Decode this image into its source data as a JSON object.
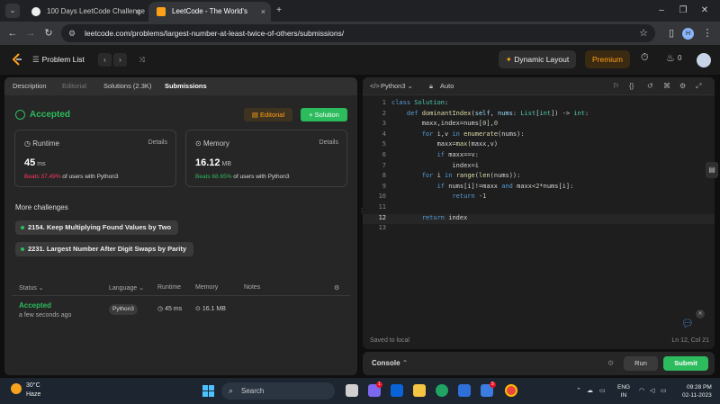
{
  "browser": {
    "tabs": [
      {
        "title": "100 Days LeetCode Challenge",
        "close": "×"
      },
      {
        "title": "LeetCode - The World's Leadin",
        "close": "×"
      }
    ],
    "new_tab": "+",
    "url": "leetcode.com/problems/largest-number-at-least-twice-of-others/submissions/",
    "profile_initial": "H"
  },
  "header": {
    "problem_list": "Problem List",
    "dynamic_layout": "Dynamic Layout",
    "premium": "Premium",
    "streak": "0"
  },
  "left": {
    "tabs": [
      "Description",
      "Editorial",
      "Solutions (2.3K)",
      "Submissions"
    ],
    "status": "Accepted",
    "editorial_btn": "Editorial",
    "solution_btn": "Solution",
    "runtime": {
      "title": "Runtime",
      "details": "Details",
      "value": "45",
      "unit": "ms",
      "beats_prefix": "Beats 37.49%",
      "beats_suffix": "of users with Python3"
    },
    "memory": {
      "title": "Memory",
      "details": "Details",
      "value": "16.12",
      "unit": "MB",
      "beats_prefix": "Beats 68.65%",
      "beats_suffix": "of users with Python3"
    },
    "more_challenges": "More challenges",
    "challenges": [
      "2154. Keep Multiplying Found Values by Two",
      "2231. Largest Number After Digit Swaps by Parity"
    ],
    "table": {
      "headers": [
        "Status",
        "Language",
        "Runtime",
        "Memory",
        "Notes"
      ],
      "row": {
        "status": "Accepted",
        "time": "a few seconds ago",
        "language": "Python3",
        "runtime": "45 ms",
        "memory": "16.1 MB"
      }
    }
  },
  "editor": {
    "language": "Python3",
    "mode": "Auto",
    "saved": "Saved to local",
    "cursor": "Ln 12, Col 21",
    "line_numbers": [
      "1",
      "2",
      "3",
      "4",
      "5",
      "6",
      "7",
      "8",
      "9",
      "10",
      "11",
      "12",
      "13"
    ],
    "lines": [
      "class Solution:",
      "    def dominantIndex(self, nums: List[int]) -> int:",
      "        maxx,index=nums[0],0",
      "        for i,v in enumerate(nums):",
      "            maxx=max(maxx,v)",
      "            if maxx==v:",
      "                index=i",
      "        for i in range(len(nums)):",
      "            if nums[i]!=maxx and maxx<2*nums[i]:",
      "                return -1",
      "",
      "        return index",
      ""
    ]
  },
  "console": {
    "label": "Console",
    "run": "Run",
    "submit": "Submit"
  },
  "taskbar": {
    "temp": "30°C",
    "weather": "Haze",
    "search": "Search",
    "lang_top": "ENG",
    "lang_bottom": "IN",
    "time": "09:28 PM",
    "date": "02-11-2023"
  },
  "colors": {
    "accent_green": "#2cbb5d",
    "accent_orange": "#ffa116",
    "beats_red": "#ff375f"
  }
}
